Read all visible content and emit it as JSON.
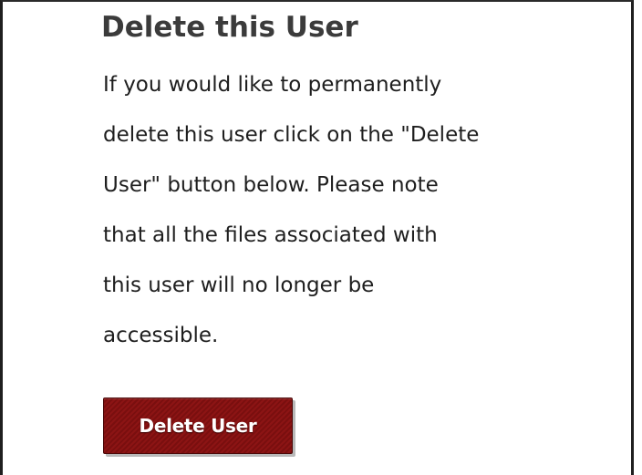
{
  "section": {
    "title": "Delete this User",
    "description_lines": [
      "If you would like to permanently",
      "delete this user click on the \"Delete",
      "User\" button below. Please note",
      "that all the files associated with",
      "this user will no longer be",
      "accessible."
    ],
    "delete_button_label": "Delete User"
  },
  "colors": {
    "button_background": "#861313",
    "title_text": "#3b3b3b",
    "border": "#1f1f1f"
  }
}
